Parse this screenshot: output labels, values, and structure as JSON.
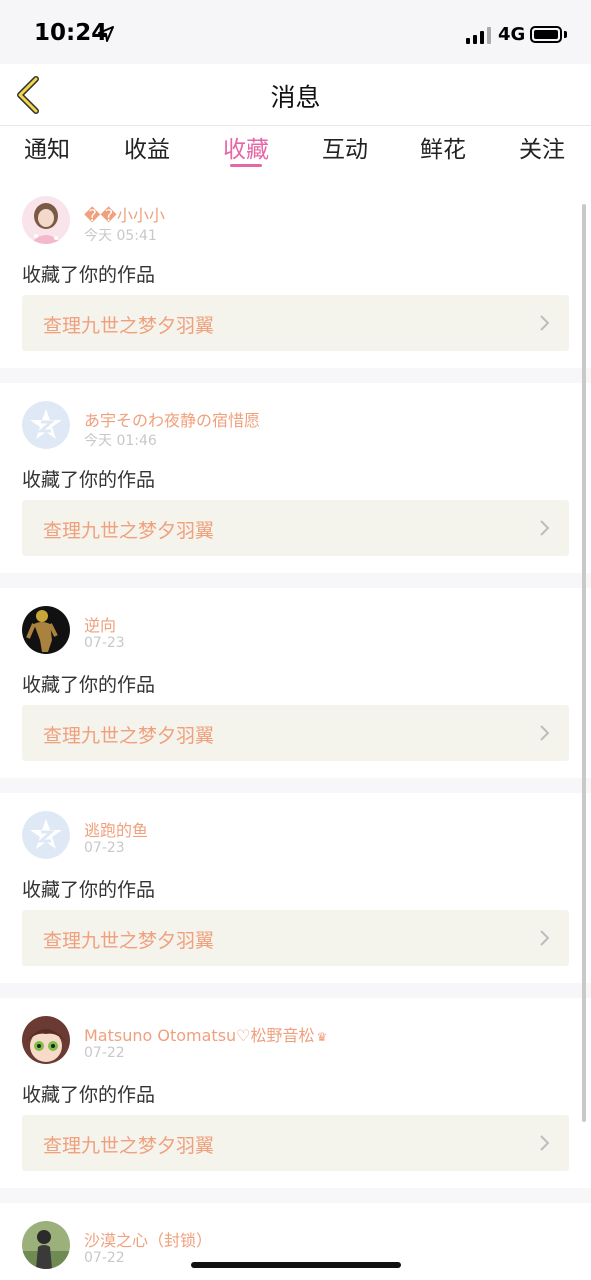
{
  "status_bar": {
    "time": "10:24",
    "network": "4G"
  },
  "header": {
    "title": "消息"
  },
  "tabs": [
    {
      "label": "通知"
    },
    {
      "label": "收益"
    },
    {
      "label": "收藏"
    },
    {
      "label": "互动"
    },
    {
      "label": "鲜花"
    },
    {
      "label": "关注"
    }
  ],
  "active_tab": "收藏",
  "colors": {
    "accent": "#e667a6",
    "name": "#f0a07d",
    "work_bg": "#f4f3ec"
  },
  "notifications": [
    {
      "user": "��小小小",
      "time": "今天 05:41",
      "action": "收藏了你的作品",
      "work": "查理九世之梦夕羽翼",
      "avatar": "girl-avatar"
    },
    {
      "user": "あ宇そのわ夜静の宿惜愿",
      "time": "今天 01:46",
      "action": "收藏了你的作品",
      "work": "查理九世之梦夕羽翼",
      "avatar": "default-star-avatar"
    },
    {
      "user": "逆向",
      "time": "07-23",
      "action": "收藏了你的作品",
      "work": "查理九世之梦夕羽翼",
      "avatar": "figure-avatar"
    },
    {
      "user": "逃跑的鱼",
      "time": "07-23",
      "action": "收藏了你的作品",
      "work": "查理九世之梦夕羽翼",
      "avatar": "default-star-avatar"
    },
    {
      "user": "Matsuno Otomatsu♡松野音松",
      "time": "07-22",
      "action": "收藏了你的作品",
      "work": "查理九世之梦夕羽翼",
      "avatar": "anime-avatar"
    },
    {
      "user": "沙漠之心（封锁）",
      "time": "07-22",
      "avatar": "photo-avatar"
    }
  ]
}
